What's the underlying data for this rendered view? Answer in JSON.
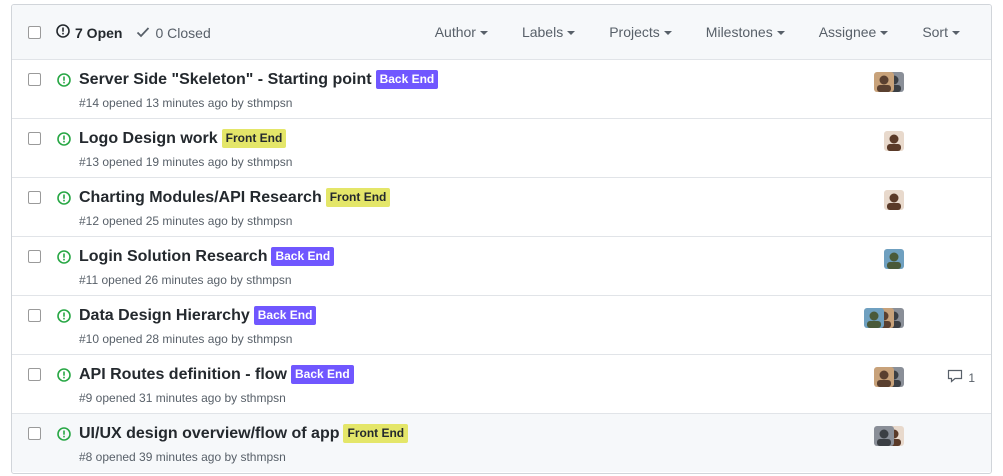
{
  "header": {
    "open_label": "7 Open",
    "closed_label": "0 Closed",
    "filters": [
      "Author",
      "Labels",
      "Projects",
      "Milestones",
      "Assignee",
      "Sort"
    ]
  },
  "colors": {
    "open_green": "#28a745",
    "back_end": "#7057ff",
    "front_end": "#e4e669"
  },
  "label_names": {
    "back_end": "Back End",
    "front_end": "Front End"
  },
  "issues": [
    {
      "title": "Server Side \"Skeleton\" - Starting point",
      "label": "Back End",
      "meta": "#14 opened 13 minutes ago by sthmpsn",
      "assignees": [
        "avatar-a",
        "avatar-b"
      ],
      "comments": ""
    },
    {
      "title": "Logo Design work",
      "label": "Front End",
      "meta": "#13 opened 19 minutes ago by sthmpsn",
      "assignees": [
        "avatar-c"
      ],
      "comments": ""
    },
    {
      "title": "Charting Modules/API Research",
      "label": "Front End",
      "meta": "#12 opened 25 minutes ago by sthmpsn",
      "assignees": [
        "avatar-c"
      ],
      "comments": ""
    },
    {
      "title": "Login Solution Research",
      "label": "Back End",
      "meta": "#11 opened 26 minutes ago by sthmpsn",
      "assignees": [
        "avatar-d"
      ],
      "comments": ""
    },
    {
      "title": "Data Design Hierarchy",
      "label": "Back End",
      "meta": "#10 opened 28 minutes ago by sthmpsn",
      "assignees": [
        "avatar-d",
        "avatar-a",
        "avatar-b"
      ],
      "comments": ""
    },
    {
      "title": "API Routes definition - flow",
      "label": "Back End",
      "meta": "#9 opened 31 minutes ago by sthmpsn",
      "assignees": [
        "avatar-a",
        "avatar-b"
      ],
      "comments": "1"
    },
    {
      "title": "UI/UX design overview/flow of app",
      "label": "Front End",
      "meta": "#8 opened 39 minutes ago by sthmpsn",
      "assignees": [
        "avatar-b",
        "avatar-c"
      ],
      "comments": ""
    }
  ]
}
